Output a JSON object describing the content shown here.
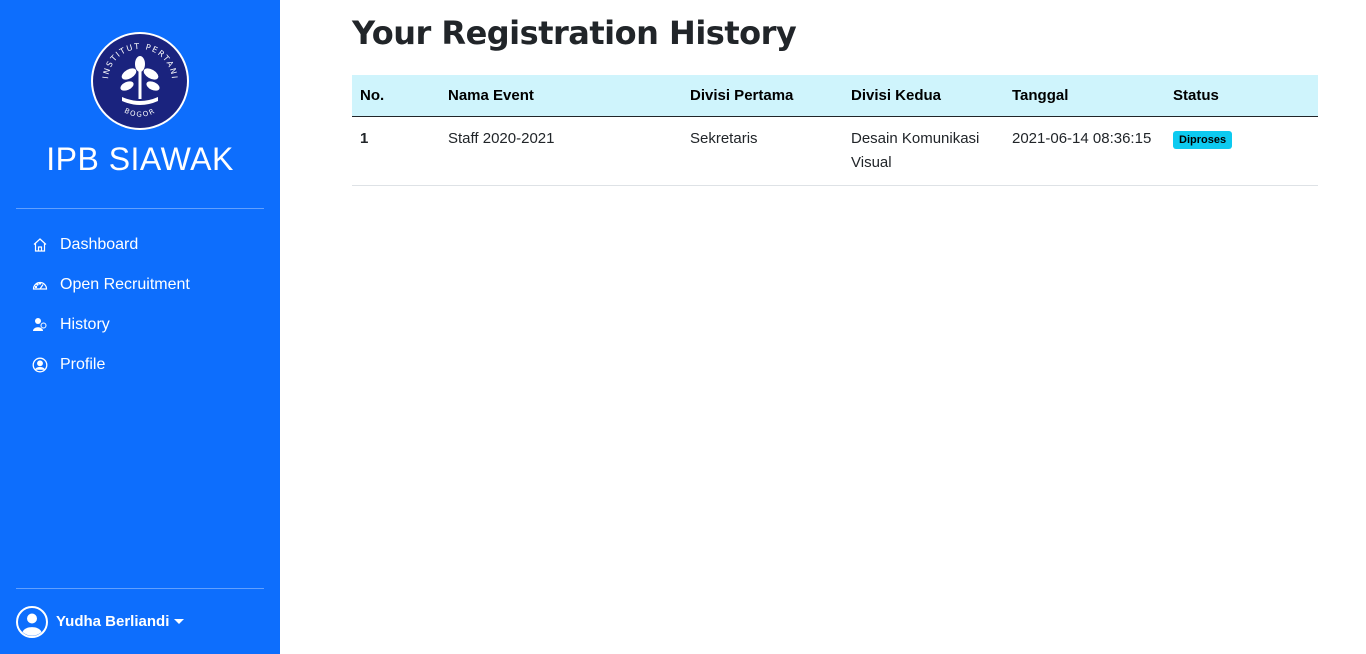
{
  "sidebar": {
    "logo_text_top": "INSTITUT PERTANIAN",
    "logo_text_bottom": "BOGOR",
    "brand": "IPB SIAWAK",
    "items": [
      {
        "label": "Dashboard",
        "icon": "house-icon"
      },
      {
        "label": "Open Recruitment",
        "icon": "speedometer-icon"
      },
      {
        "label": "History",
        "icon": "people-icon"
      },
      {
        "label": "Profile",
        "icon": "person-circle-icon"
      }
    ],
    "user": {
      "name": "Yudha Berliandi"
    }
  },
  "main": {
    "title": "Your Registration History",
    "table": {
      "headers": [
        "No.",
        "Nama Event",
        "Divisi Pertama",
        "Divisi Kedua",
        "Tanggal",
        "Status"
      ],
      "rows": [
        {
          "no": "1",
          "event": "Staff 2020-2021",
          "div1": "Sekretaris",
          "div2": "Desain Komunikasi Visual",
          "date": "2021-06-14 08:36:15",
          "status": "Diproses"
        }
      ]
    }
  },
  "colors": {
    "sidebar": "#0d6efd",
    "table_header": "#cff4fc",
    "badge": "#0dcaf0"
  }
}
